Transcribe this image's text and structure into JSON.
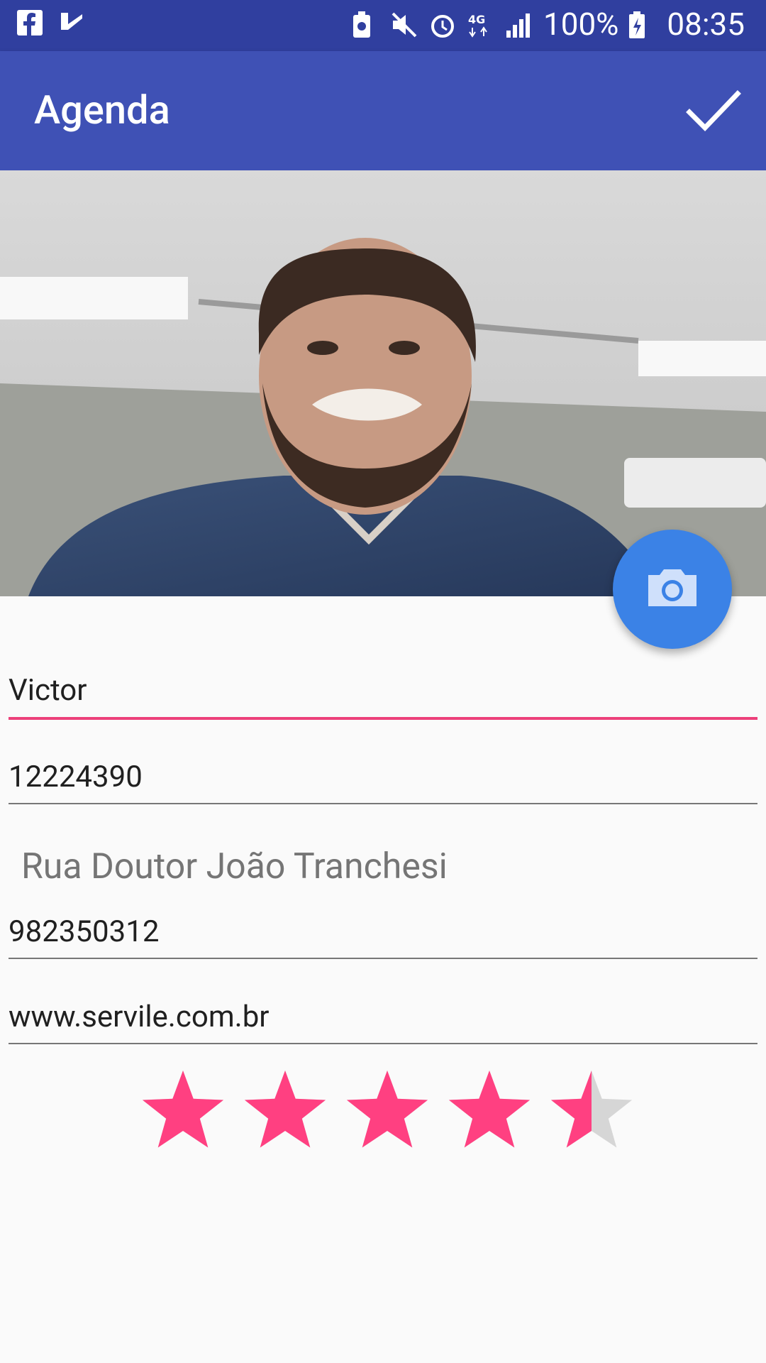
{
  "status_bar": {
    "left_icons": [
      "facebook-icon",
      "inbox-check-icon"
    ],
    "right_icons": [
      "battery-saver-icon",
      "mute-icon",
      "alarm-icon",
      "4g-icon",
      "signal-icon"
    ],
    "battery": "100%",
    "time": "08:35"
  },
  "toolbar": {
    "title": "Agenda",
    "confirm_icon": "check-icon"
  },
  "photo": {
    "icon": "camera-icon"
  },
  "form": {
    "name": "Victor",
    "phone": "12224390",
    "address": "Rua Doutor João Tranchesi",
    "mobile": "982350312",
    "website": "www.servile.com.br"
  },
  "rating": {
    "value": 4.5,
    "max": 5,
    "colors": {
      "filled": "#ff4081",
      "empty": "#d6d6d6"
    }
  },
  "colors": {
    "primary": "#3f51b5",
    "primary_dark": "#303f9f",
    "accent": "#ec407a",
    "fab": "#3b82e6"
  }
}
